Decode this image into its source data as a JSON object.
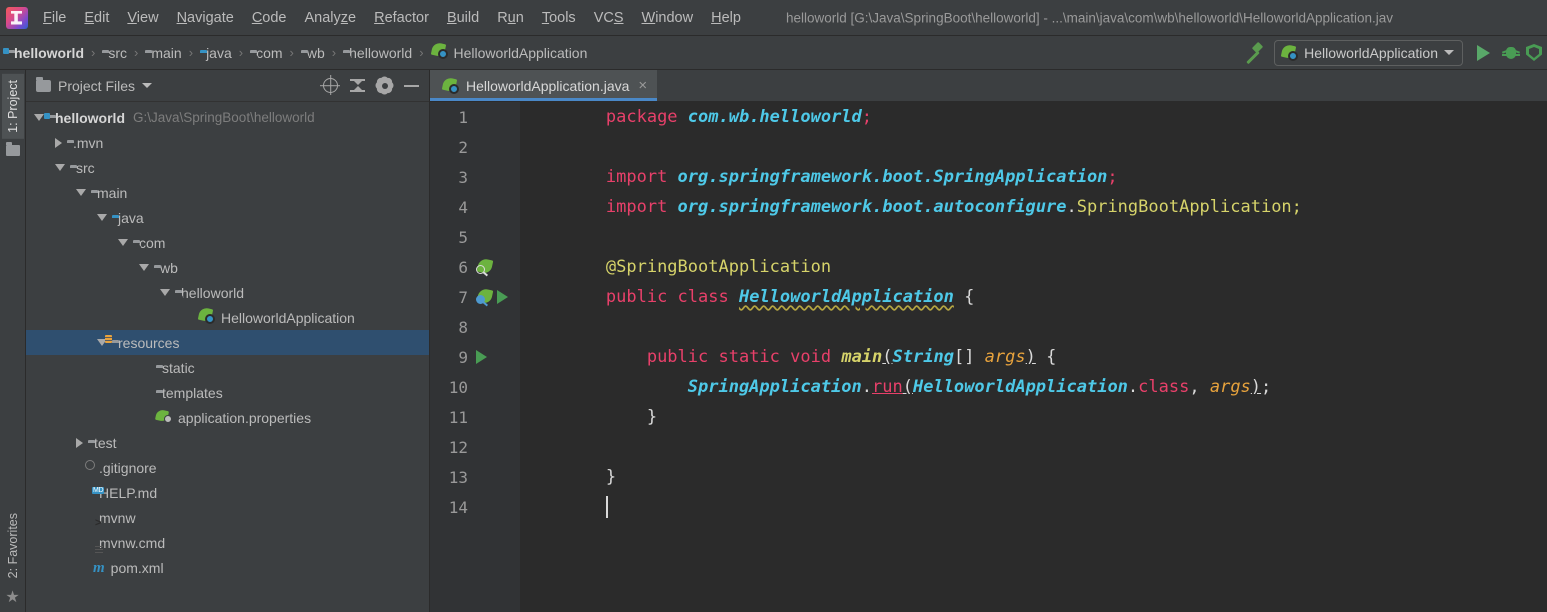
{
  "menubar": {
    "items": [
      {
        "label": "File",
        "mnemonic": "F"
      },
      {
        "label": "Edit",
        "mnemonic": "E"
      },
      {
        "label": "View",
        "mnemonic": "V"
      },
      {
        "label": "Navigate",
        "mnemonic": "N"
      },
      {
        "label": "Code",
        "mnemonic": "C"
      },
      {
        "label": "Analyze",
        "mnemonic": "z"
      },
      {
        "label": "Refactor",
        "mnemonic": "R"
      },
      {
        "label": "Build",
        "mnemonic": "B"
      },
      {
        "label": "Run",
        "mnemonic": "u"
      },
      {
        "label": "Tools",
        "mnemonic": "T"
      },
      {
        "label": "VCS",
        "mnemonic": "S"
      },
      {
        "label": "Window",
        "mnemonic": "W"
      },
      {
        "label": "Help",
        "mnemonic": "H"
      }
    ],
    "window_title": "helloworld [G:\\Java\\SpringBoot\\helloworld] - ...\\main\\java\\com\\wb\\helloworld\\HelloworldApplication.jav"
  },
  "breadcrumb": {
    "items": [
      {
        "label": "helloworld",
        "icon": "module-folder-icon"
      },
      {
        "label": "src",
        "icon": "folder-icon"
      },
      {
        "label": "main",
        "icon": "folder-icon"
      },
      {
        "label": "java",
        "icon": "source-root-folder-icon"
      },
      {
        "label": "com",
        "icon": "package-icon"
      },
      {
        "label": "wb",
        "icon": "package-icon"
      },
      {
        "label": "helloworld",
        "icon": "package-icon"
      },
      {
        "label": "HelloworldApplication",
        "icon": "spring-class-icon"
      }
    ],
    "separator": "›"
  },
  "toolbar": {
    "build_label": "Build",
    "run_configuration": "HelloworldApplication",
    "run_label": "Run",
    "debug_label": "Debug",
    "coverage_label": "Run with Coverage"
  },
  "left_strip": {
    "project_tab": "1: Project",
    "project_tab_mnemonic": "1",
    "favorites_tab": "2: Favorites",
    "favorites_tab_mnemonic": "2",
    "star_glyph": "★"
  },
  "project_panel": {
    "title": "Project Files",
    "actions": [
      "locate-icon",
      "collapse-all-icon",
      "settings-icon",
      "minimize-icon"
    ],
    "tree": [
      {
        "label": "helloworld",
        "sub": "G:\\Java\\SpringBoot\\helloworld",
        "indent": 0,
        "arrow": "open",
        "icon": "module-folder-icon",
        "bold": true,
        "selected": false
      },
      {
        "label": ".mvn",
        "sub": "",
        "indent": 1,
        "arrow": "closed",
        "icon": "folder-icon",
        "bold": false,
        "selected": false
      },
      {
        "label": "src",
        "sub": "",
        "indent": 1,
        "arrow": "open",
        "icon": "folder-icon",
        "bold": false,
        "selected": false
      },
      {
        "label": "main",
        "sub": "",
        "indent": 2,
        "arrow": "open",
        "icon": "folder-icon",
        "bold": false,
        "selected": false
      },
      {
        "label": "java",
        "sub": "",
        "indent": 3,
        "arrow": "open",
        "icon": "source-root-folder-icon",
        "bold": false,
        "selected": false
      },
      {
        "label": "com",
        "sub": "",
        "indent": 4,
        "arrow": "open",
        "icon": "package-icon",
        "bold": false,
        "selected": false
      },
      {
        "label": "wb",
        "sub": "",
        "indent": 5,
        "arrow": "open",
        "icon": "package-icon",
        "bold": false,
        "selected": false
      },
      {
        "label": "helloworld",
        "sub": "",
        "indent": 6,
        "arrow": "open",
        "icon": "package-icon",
        "bold": false,
        "selected": false
      },
      {
        "label": "HelloworldApplication",
        "sub": "",
        "indent": 7,
        "arrow": "none",
        "icon": "spring-class-icon",
        "bold": false,
        "selected": false
      },
      {
        "label": "resources",
        "sub": "",
        "indent": 3,
        "arrow": "open",
        "icon": "resources-folder-icon",
        "bold": false,
        "selected": true
      },
      {
        "label": "static",
        "sub": "",
        "indent": 5,
        "arrow": "none",
        "icon": "folder-icon",
        "bold": false,
        "selected": false
      },
      {
        "label": "templates",
        "sub": "",
        "indent": 5,
        "arrow": "none",
        "icon": "folder-icon",
        "bold": false,
        "selected": false
      },
      {
        "label": "application.properties",
        "sub": "",
        "indent": 5,
        "arrow": "none",
        "icon": "spring-properties-icon",
        "bold": false,
        "selected": false
      },
      {
        "label": "test",
        "sub": "",
        "indent": 2,
        "arrow": "closed",
        "icon": "folder-icon",
        "bold": false,
        "selected": false
      },
      {
        "label": ".gitignore",
        "sub": "",
        "indent": 2,
        "arrow": "none",
        "icon": "gitignore-icon",
        "bold": false,
        "selected": false
      },
      {
        "label": "HELP.md",
        "sub": "",
        "indent": 2,
        "arrow": "none",
        "icon": "markdown-icon",
        "bold": false,
        "selected": false
      },
      {
        "label": "mvnw",
        "sub": "",
        "indent": 2,
        "arrow": "none",
        "icon": "shell-script-icon",
        "bold": false,
        "selected": false
      },
      {
        "label": "mvnw.cmd",
        "sub": "",
        "indent": 2,
        "arrow": "none",
        "icon": "cmd-file-icon",
        "bold": false,
        "selected": false
      },
      {
        "label": "pom.xml",
        "sub": "",
        "indent": 2,
        "arrow": "none",
        "icon": "maven-icon",
        "bold": false,
        "selected": false
      }
    ]
  },
  "editor": {
    "tab": {
      "label": "HelloworldApplication.java",
      "close_glyph": "×",
      "icon": "spring-class-icon",
      "active": true
    },
    "lines": [
      {
        "num": 1,
        "gutter": [],
        "tokens": [
          {
            "t": "        ",
            "c": "plain"
          },
          {
            "t": "package ",
            "c": "kw2"
          },
          {
            "t": "com.wb.helloworld",
            "c": "pkg"
          },
          {
            "t": ";",
            "c": "kw2"
          }
        ]
      },
      {
        "num": 2,
        "gutter": [],
        "tokens": []
      },
      {
        "num": 3,
        "gutter": [],
        "tokens": [
          {
            "t": "        ",
            "c": "plain"
          },
          {
            "t": "import ",
            "c": "kw2"
          },
          {
            "t": "org.springframework.boot.SpringApplication",
            "c": "pkg"
          },
          {
            "t": ";",
            "c": "kw2"
          }
        ]
      },
      {
        "num": 4,
        "gutter": [],
        "tokens": [
          {
            "t": "        ",
            "c": "plain"
          },
          {
            "t": "import ",
            "c": "kw2"
          },
          {
            "t": "org.springframework.boot.autoconfigure",
            "c": "pkg"
          },
          {
            "t": ".",
            "c": "punc"
          },
          {
            "t": "SpringBootApplication",
            "c": "cls-plain"
          },
          {
            "t": ";",
            "c": "cls-plain"
          }
        ]
      },
      {
        "num": 5,
        "gutter": [],
        "tokens": []
      },
      {
        "num": 6,
        "gutter": [
          "spring-bean-gutter-icon"
        ],
        "tokens": [
          {
            "t": "        ",
            "c": "plain"
          },
          {
            "t": "@SpringBootApplication",
            "c": "anno"
          }
        ]
      },
      {
        "num": 7,
        "gutter": [
          "spring-bean-gutter-icon",
          "run-gutter-icon"
        ],
        "tokens": [
          {
            "t": "        ",
            "c": "plain"
          },
          {
            "t": "public ",
            "c": "kw2"
          },
          {
            "t": "class ",
            "c": "kw2"
          },
          {
            "t": "HelloworldApplication",
            "c": "cls warn"
          },
          {
            "t": " {",
            "c": "punc"
          }
        ]
      },
      {
        "num": 8,
        "gutter": [],
        "tokens": []
      },
      {
        "num": 9,
        "gutter": [
          "run-gutter-icon"
        ],
        "tokens": [
          {
            "t": "            ",
            "c": "plain"
          },
          {
            "t": "public ",
            "c": "kw2"
          },
          {
            "t": "static ",
            "c": "kw2"
          },
          {
            "t": "void ",
            "c": "kw2"
          },
          {
            "t": "main",
            "c": "mth"
          },
          {
            "t": "(",
            "c": "punc-u"
          },
          {
            "t": "String",
            "c": "cls"
          },
          {
            "t": "[] ",
            "c": "punc"
          },
          {
            "t": "args",
            "c": "param"
          },
          {
            "t": ")",
            "c": "punc-u"
          },
          {
            "t": " {",
            "c": "punc"
          }
        ]
      },
      {
        "num": 10,
        "gutter": [],
        "tokens": [
          {
            "t": "                ",
            "c": "plain"
          },
          {
            "t": "SpringApplication",
            "c": "cls"
          },
          {
            "t": ".",
            "c": "punc"
          },
          {
            "t": "run",
            "c": "mth2"
          },
          {
            "t": "(",
            "c": "punc-u"
          },
          {
            "t": "HelloworldApplication",
            "c": "cls"
          },
          {
            "t": ".",
            "c": "punc"
          },
          {
            "t": "class",
            "c": "kw2"
          },
          {
            "t": ", ",
            "c": "punc"
          },
          {
            "t": "args",
            "c": "param"
          },
          {
            "t": ")",
            "c": "punc-u"
          },
          {
            "t": ";",
            "c": "punc"
          }
        ]
      },
      {
        "num": 11,
        "gutter": [],
        "tokens": [
          {
            "t": "            ",
            "c": "plain"
          },
          {
            "t": "}",
            "c": "punc"
          }
        ]
      },
      {
        "num": 12,
        "gutter": [],
        "tokens": []
      },
      {
        "num": 13,
        "gutter": [],
        "tokens": [
          {
            "t": "        ",
            "c": "plain"
          },
          {
            "t": "}",
            "c": "punc"
          }
        ]
      },
      {
        "num": 14,
        "gutter": [],
        "tokens": [
          {
            "t": "        ",
            "c": "plain"
          },
          {
            "t": "",
            "c": "caret"
          }
        ]
      }
    ]
  },
  "colors": {
    "chrome_bg": "#3c3f41",
    "editor_bg": "#2b2b2b",
    "gutter_bg": "#313335",
    "selection_blue": "#2f4f6f",
    "tab_active_underline": "#4a88c7",
    "spring_green": "#6cb33f",
    "run_green": "#499c54",
    "keyword_pink": "#e8406a",
    "class_cyan": "#4ec9e8",
    "annotation_yellow": "#d6d36a",
    "param_orange": "#e8a33d",
    "source_root_blue": "#3592c4"
  }
}
